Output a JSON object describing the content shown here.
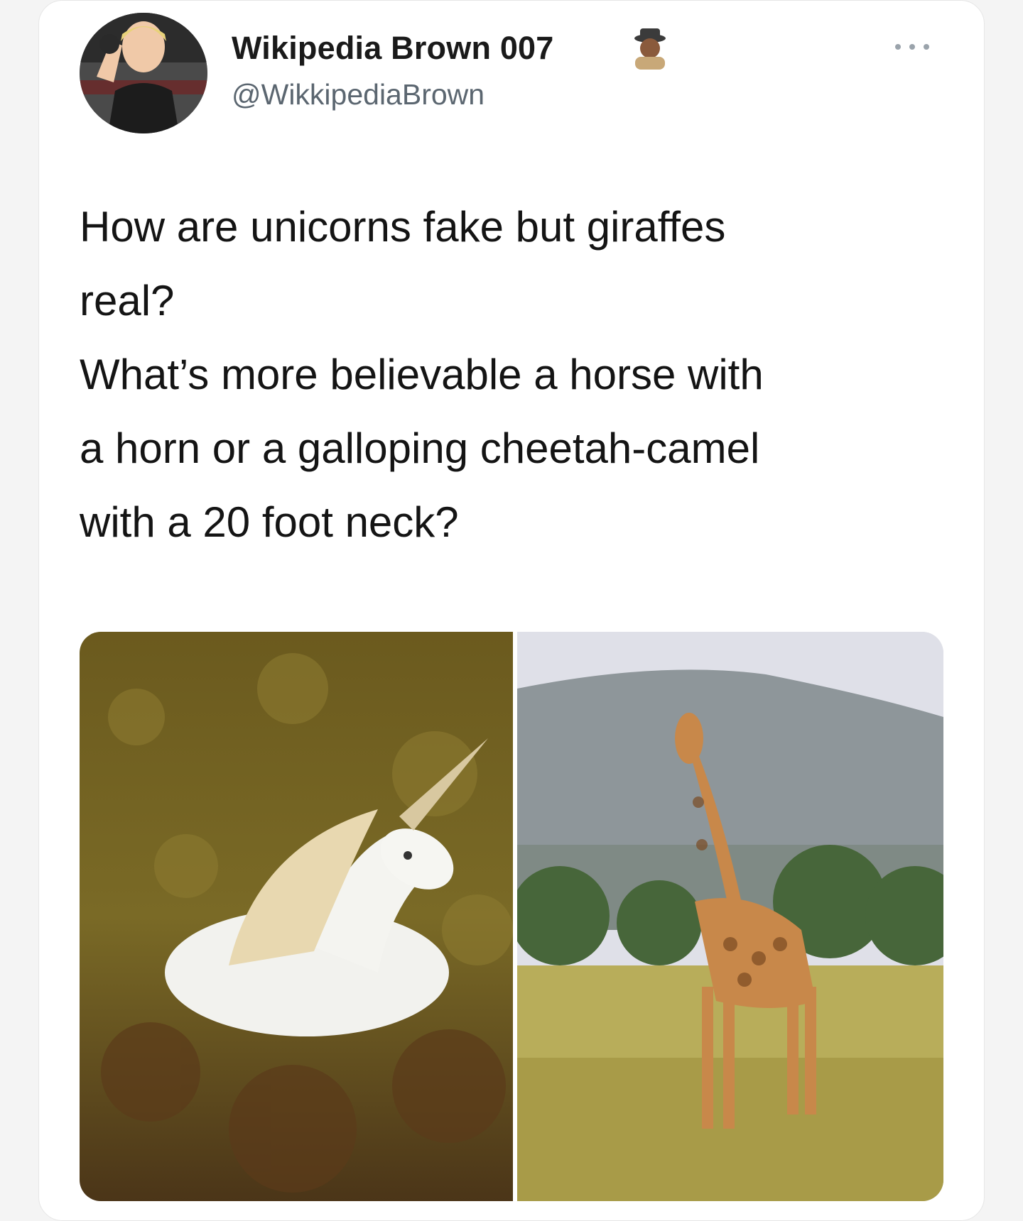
{
  "tweet": {
    "author": {
      "display_name": "Wikipedia Brown 007",
      "handle": "@WikkipediaBrown",
      "emoji": "detective-emoji"
    },
    "text_lines": [
      "How are unicorns fake but giraffes",
      "real?",
      "What’s more believable a horse with",
      "a horn or a galloping cheetah-camel",
      "with a 20 foot neck?"
    ],
    "media": [
      {
        "subject": "unicorn-photo"
      },
      {
        "subject": "giraffe-photo"
      }
    ],
    "more_icon": "more-options-icon"
  },
  "colors": {
    "handle": "#5b6670",
    "text": "#141414",
    "card_border": "#e6e6e6"
  }
}
